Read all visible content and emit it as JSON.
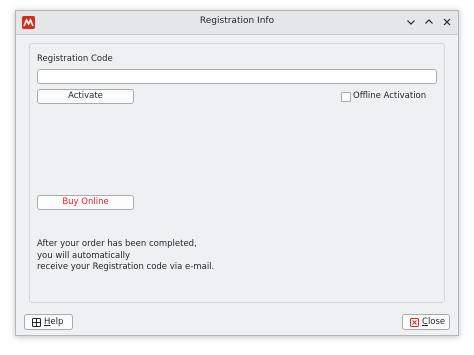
{
  "window": {
    "title": "Registration Info",
    "controls": [
      "chevron-down-icon",
      "chevron-up-icon",
      "close-icon"
    ]
  },
  "form": {
    "code_label": "Registration Code",
    "code_value": "",
    "code_placeholder": "",
    "activate_label": "Activate",
    "offline_label": "Offline Activation",
    "offline_checked": false,
    "buy_label": "Buy Online",
    "info_lines": [
      "After your order has been completed,",
      "you will automatically",
      "receive your Registration code via e-mail."
    ]
  },
  "footer": {
    "help_label": "Help",
    "close_label": "Close"
  },
  "colors": {
    "accent": "#d62a22",
    "buy_text": "#e01b24",
    "window_bg": "#eff0f1"
  }
}
